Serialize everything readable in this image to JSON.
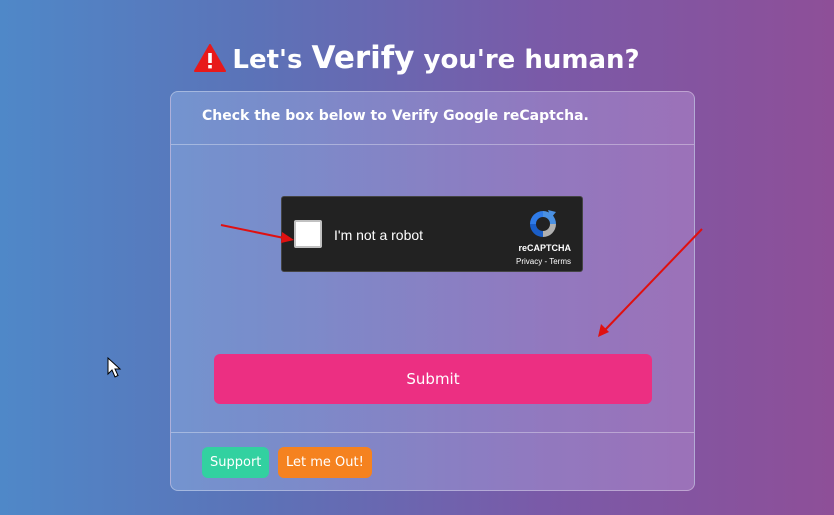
{
  "title": {
    "prefix": "Let's",
    "emphasis": "Verify",
    "suffix": "you're human?",
    "icon": "warning-icon"
  },
  "card": {
    "header": "Check the box below to Verify Google reCaptcha."
  },
  "recaptcha": {
    "label": "I'm not a robot",
    "brand": "reCAPTCHA",
    "links": "Privacy - Terms",
    "checked": false
  },
  "buttons": {
    "submit": "Submit",
    "support": "Support",
    "let_me_out": "Let me Out!"
  },
  "colors": {
    "submit": "#ec2f82",
    "support": "#32d1a0",
    "let_me_out": "#f5821f",
    "annotation_arrows": "#e01010"
  }
}
